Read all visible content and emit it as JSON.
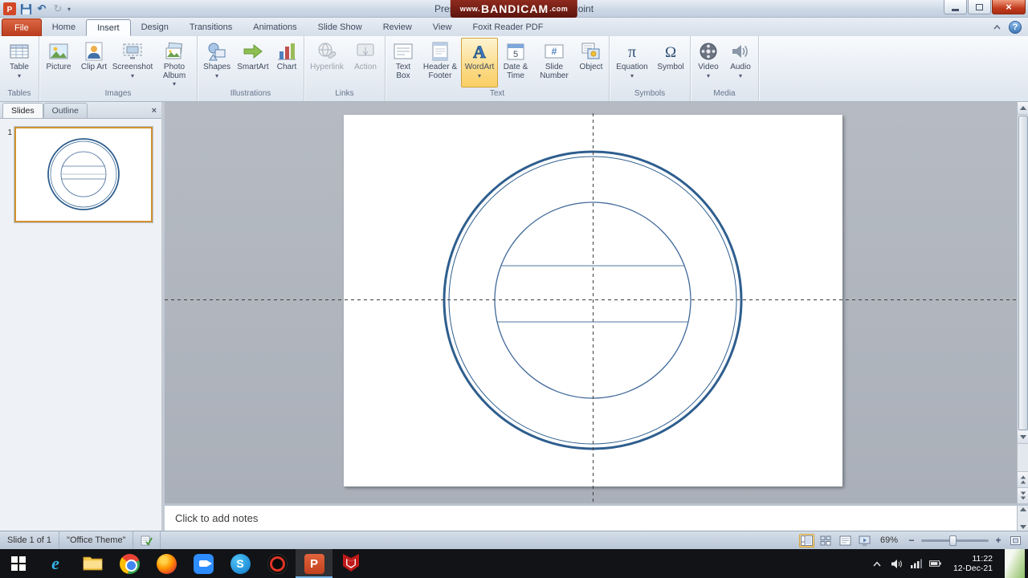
{
  "titlebar": {
    "title": "Presentation1 - Microsoft PowerPoint",
    "watermark": {
      "prefix": "www.",
      "name": "BANDICAM",
      "suffix": ".com"
    }
  },
  "tabs": [
    {
      "label": "File"
    },
    {
      "label": "Home"
    },
    {
      "label": "Insert"
    },
    {
      "label": "Design"
    },
    {
      "label": "Transitions"
    },
    {
      "label": "Animations"
    },
    {
      "label": "Slide Show"
    },
    {
      "label": "Review"
    },
    {
      "label": "View"
    },
    {
      "label": "Foxit Reader PDF"
    }
  ],
  "ribbon": {
    "groups": [
      {
        "label": "Tables",
        "buttons": [
          {
            "label": "Table"
          }
        ]
      },
      {
        "label": "Images",
        "buttons": [
          {
            "label": "Picture"
          },
          {
            "label": "Clip Art"
          },
          {
            "label": "Screenshot"
          },
          {
            "label": "Photo Album"
          }
        ]
      },
      {
        "label": "Illustrations",
        "buttons": [
          {
            "label": "Shapes"
          },
          {
            "label": "SmartArt"
          },
          {
            "label": "Chart"
          }
        ]
      },
      {
        "label": "Links",
        "buttons": [
          {
            "label": "Hyperlink"
          },
          {
            "label": "Action"
          }
        ]
      },
      {
        "label": "Text",
        "buttons": [
          {
            "label": "Text Box"
          },
          {
            "label": "Header & Footer"
          },
          {
            "label": "WordArt"
          },
          {
            "label": "Date & Time"
          },
          {
            "label": "Slide Number"
          },
          {
            "label": "Object"
          }
        ]
      },
      {
        "label": "Symbols",
        "buttons": [
          {
            "label": "Equation"
          },
          {
            "label": "Symbol"
          }
        ]
      },
      {
        "label": "Media",
        "buttons": [
          {
            "label": "Video"
          },
          {
            "label": "Audio"
          }
        ]
      }
    ]
  },
  "slides_panel": {
    "tabs": [
      {
        "label": "Slides"
      },
      {
        "label": "Outline"
      }
    ],
    "slide_number": "1"
  },
  "notes": {
    "placeholder": "Click to add notes"
  },
  "status_bar": {
    "slide_indicator": "Slide 1 of 1",
    "theme_name": "\"Office Theme\"",
    "zoom_level": "69%"
  },
  "taskbar": {
    "clock": {
      "time": "11:22",
      "date": "12-Dec-21"
    }
  },
  "colors": {
    "file_tab": "#b83c1d",
    "wordart_selected": "#fbd87f",
    "watermark_bg": "#6d1b14",
    "drawing_stroke": "#2e5e8e",
    "taskbar_bg": "#121316"
  }
}
